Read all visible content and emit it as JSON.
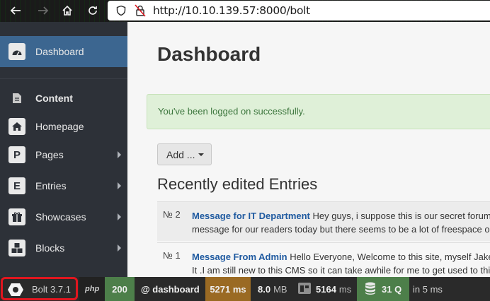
{
  "browser": {
    "url": "http://10.10.139.57:8000/bolt",
    "icons": [
      "back-arrow-icon",
      "forward-arrow-icon",
      "home-icon",
      "reload-icon",
      "shield-icon",
      "insecure-lock-icon"
    ]
  },
  "sidebar": {
    "items": [
      {
        "label": "Dashboard",
        "icon": "dashboard-icon",
        "active": true
      },
      {
        "label": "Content",
        "icon": "document-icon",
        "header": true
      },
      {
        "label": "Homepage",
        "icon": "home-icon"
      },
      {
        "label": "Pages",
        "icon_letter": "P"
      },
      {
        "label": "Entries",
        "icon_letter": "E"
      },
      {
        "label": "Showcases",
        "icon": "gift-icon"
      },
      {
        "label": "Blocks",
        "icon": "cubes-icon"
      }
    ]
  },
  "main": {
    "title": "Dashboard",
    "alert": "You've been logged on successfully.",
    "add_button": "Add ...",
    "section_title": "Recently edited Entries",
    "entries": [
      {
        "num": "№ 2",
        "title": "Message for IT Department",
        "line1": "Hey guys, i suppose this is our secret forum",
        "line2": "message for our readers today but there seems to be a lot of freespace ou"
      },
      {
        "num": "№ 1",
        "title": "Message From Admin",
        "line1": "Hello Everyone, Welcome to this site, myself Jake",
        "line2": "It .I am still new to this CMS so it can take awhile for me to get used to thi"
      }
    ]
  },
  "debug_bar": {
    "bolt_version": "Bolt 3.7.1",
    "php": "php",
    "status": "200",
    "route": "@ dashboard",
    "time": "5271 ms",
    "memory_value": "8.0",
    "memory_unit": "MB",
    "template_value": "5164",
    "template_unit": "ms",
    "queries": "31 Q",
    "query_time": "in 5 ms"
  },
  "colors": {
    "accent_active": "#3c6690",
    "status_green": "#4d7f4a",
    "time_orange": "#9a6a23",
    "highlight_red": "#e0161f"
  }
}
